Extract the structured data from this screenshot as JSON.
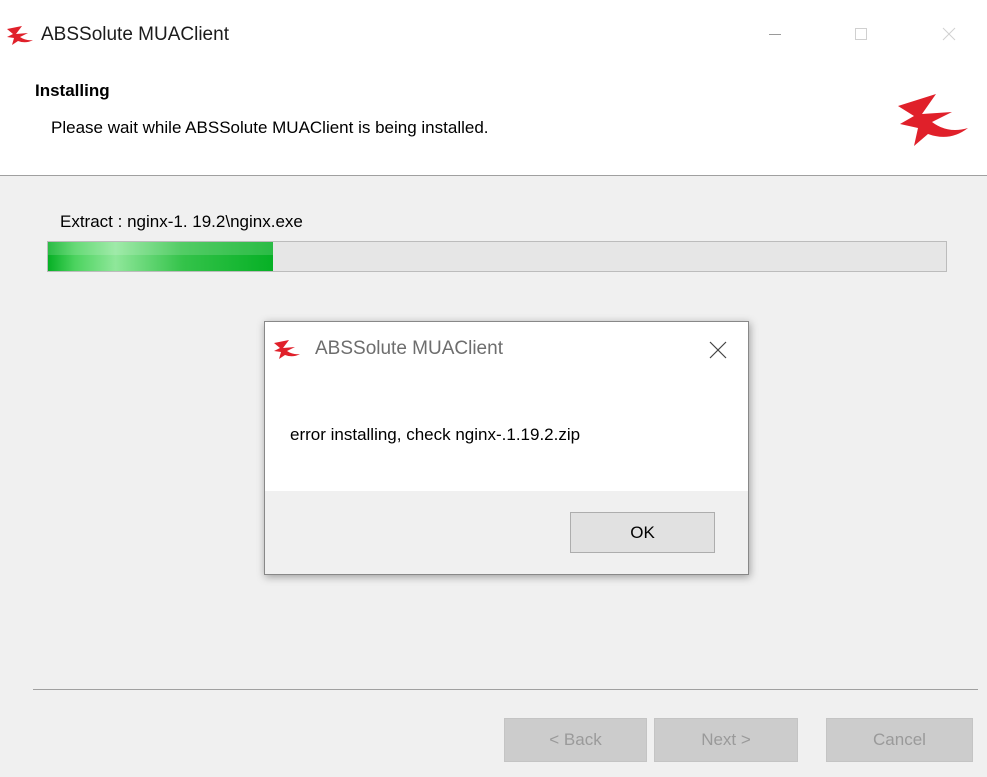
{
  "window": {
    "title": "ABSSolute MUAClient",
    "controls": {
      "minimize_icon": "minimize-icon",
      "maximize_icon": "maximize-icon",
      "close_icon": "close-icon"
    }
  },
  "header": {
    "heading": "Installing",
    "subheading": "Please wait while ABSSolute MUAClient is being installed.",
    "logo_icon": "abssolute-logo-icon"
  },
  "progress": {
    "status_text": "Extract : nginx-1. 19.2\\nginx.exe",
    "fraction": 0.25,
    "fill_color": "#06b025"
  },
  "buttons": {
    "back_label": "< Back",
    "next_label": "Next >",
    "cancel_label": "Cancel"
  },
  "dialog": {
    "title": "ABSSolute MUAClient",
    "message": "error installing, check nginx-.1.19.2.zip",
    "ok_label": "OK"
  },
  "colors": {
    "brand_red": "#e0202a",
    "progress_green": "#06b025"
  }
}
